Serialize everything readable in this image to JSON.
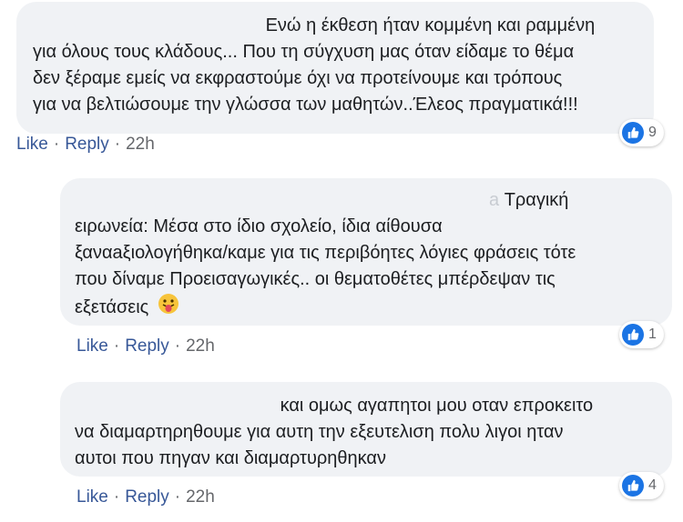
{
  "comments": [
    {
      "lines": [
        "Ενώ η έκθεση ήταν κομμένη και ραμμένη",
        "για όλους τους κλάδους... Που τη σύγχυση μας όταν είδαμε το θέμα",
        "δεν ξέραμε εμείς να εκφραστούμε όχι να προτείνουμε και τρόπους",
        "για να βελτιώσουμε την γλώσσα των μαθητών..Έλεος πραγματικά!!!"
      ],
      "actions": {
        "like": "Like",
        "reply": "Reply",
        "time": "22h",
        "sep": "·"
      },
      "reactions": "9"
    },
    {
      "name_tail": "a",
      "lines": [
        "Τραγική",
        "ειρωνεία: Μέσα στο ίδιο σχολείο, ίδια αίθουσα",
        "ξαναaξιολογήθηκα/καμε για τις περιβόητες λόγιες φράσεις τότε",
        "που δίναμε Προεισαγωγικές.. οι θεματοθέτες μπέρδεψαν τις",
        "εξετάσεις"
      ],
      "emoji": "tongue-out-emoji",
      "actions": {
        "like": "Like",
        "reply": "Reply",
        "time": "22h",
        "sep": "·"
      },
      "reactions": "1"
    },
    {
      "lines": [
        "και ομως αγαπητοι μου οταν επροκειτο",
        "να διαμαρτηρηθουμε για αυτη την εξευτελιση πολυ λιγοι ηταν",
        "αυτοι που πηγαν και διαμαρτυρηθηκαν"
      ],
      "actions": {
        "like": "Like",
        "reply": "Reply",
        "time": "22h",
        "sep": "·"
      },
      "reactions": "4"
    }
  ],
  "colors": {
    "link": "#385898",
    "bubble": "#f0f2f5",
    "like_badge": "#1b74e4"
  }
}
